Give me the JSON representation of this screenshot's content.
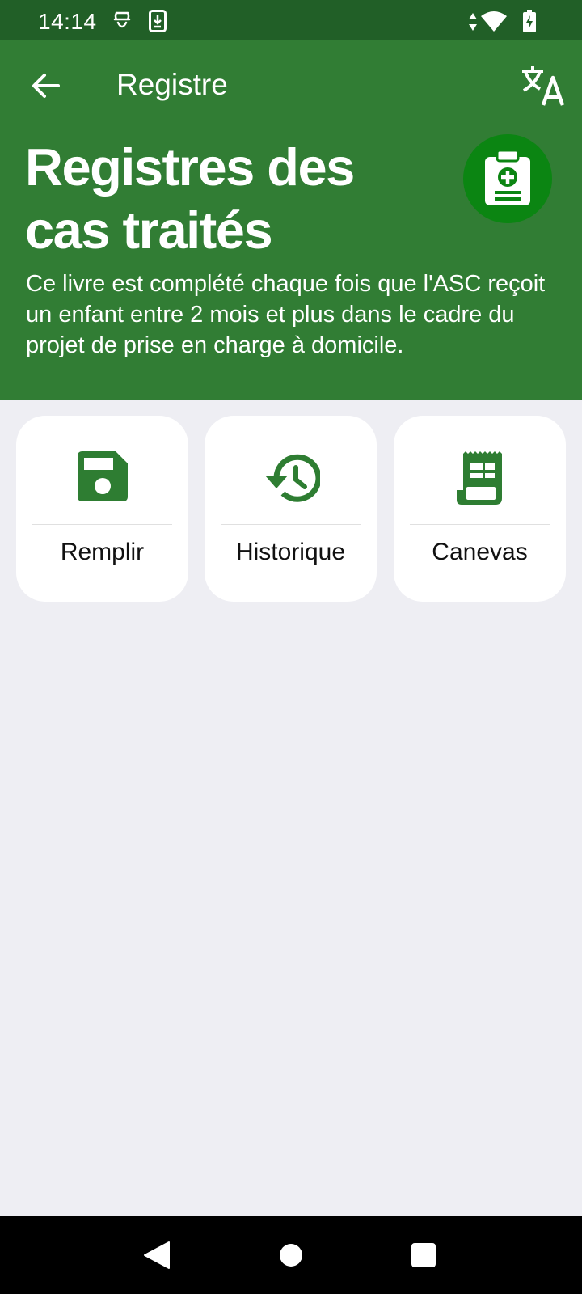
{
  "status_bar": {
    "time": "14:14",
    "icons": [
      "notification-app-icon",
      "download-icon",
      "data-arrows-icon",
      "wifi-icon",
      "battery-charging-icon"
    ]
  },
  "toolbar": {
    "title": "Registre",
    "back_icon": "arrow-left-icon",
    "translate_icon": "translate-icon"
  },
  "header": {
    "title": "Registres des cas traités",
    "description": "Ce livre est complété chaque fois que l'ASC reçoit un enfant entre 2 mois et plus dans le cadre du projet de prise en charge à domicile.",
    "badge_icon": "medical-clipboard-icon"
  },
  "cards": [
    {
      "label": "Remplir",
      "icon": "save-icon"
    },
    {
      "label": "Historique",
      "icon": "history-icon"
    },
    {
      "label": "Canevas",
      "icon": "receipt-icon"
    }
  ],
  "nav_bar": {
    "buttons": [
      "back-triangle-icon",
      "home-circle-icon",
      "recents-square-icon"
    ]
  },
  "colors": {
    "status_bar": "#215f27",
    "header": "#317d34",
    "accent": "#2e7d32",
    "badge": "#0b8512",
    "background": "#eeeef3"
  }
}
